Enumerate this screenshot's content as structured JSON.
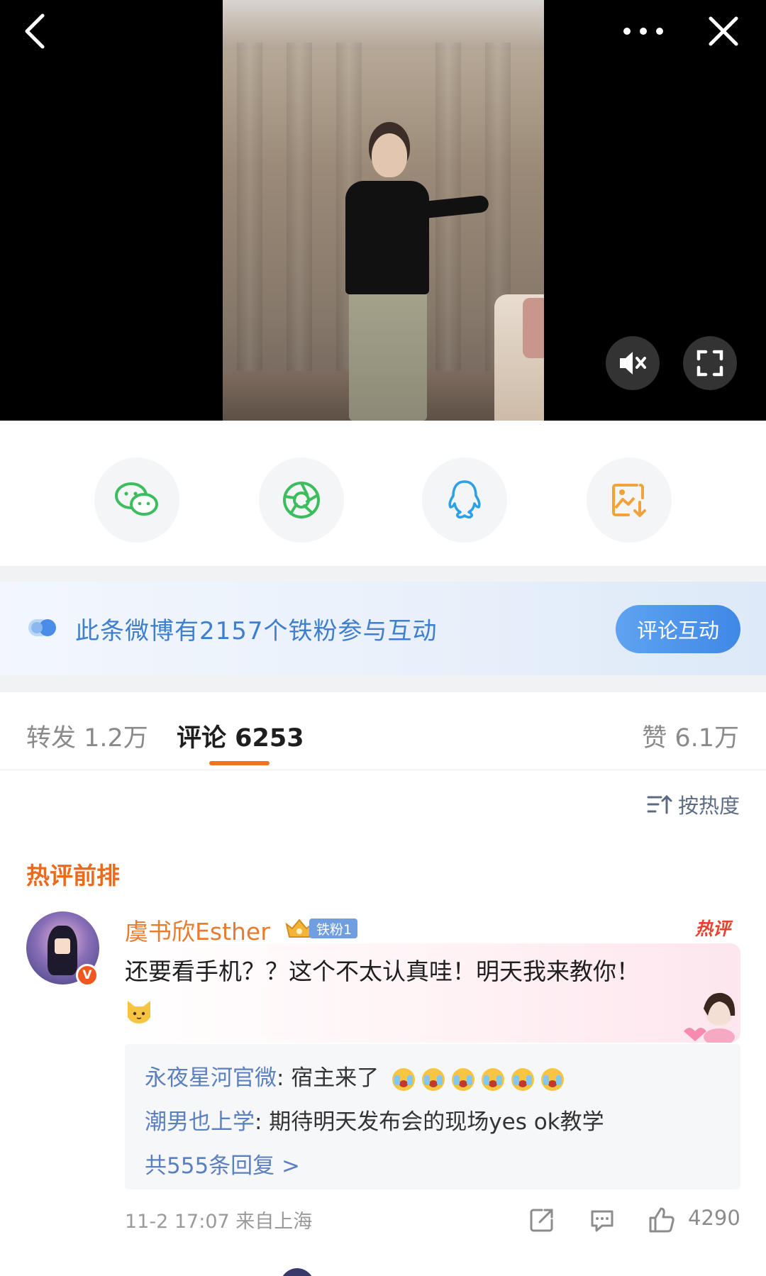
{
  "share": {
    "items": [
      {
        "name": "wechat-share",
        "color": "#3dbd5e"
      },
      {
        "name": "moments-share",
        "color": "#3dbd5e"
      },
      {
        "name": "qq-share",
        "color": "#2ea0e8"
      },
      {
        "name": "save-image",
        "color": "#f1a23a"
      }
    ]
  },
  "banner": {
    "text": "此条微博有2157个铁粉参与互动",
    "button_label": "评论互动"
  },
  "tabs": {
    "repost": "转发 1.2万",
    "comments": "评论 6253",
    "likes": "赞 6.1万"
  },
  "sort": {
    "label": "按热度"
  },
  "hot_heading": "热评前排",
  "comment": {
    "author": "虞书欣Esther",
    "fan_badge": "铁粉1",
    "hot_badge": "热评",
    "verified": "V",
    "text": "还要看手机？？这个不太认真哇！明天我来教你！",
    "replies": [
      {
        "user": "永夜星河官微",
        "text": ": 宿主来了"
      },
      {
        "user": "潮男也上学",
        "text": ": 期待明天发布会的现场yes ok教学"
      }
    ],
    "more_replies": "共555条回复 >",
    "meta": "11-2 17:07  来自上海",
    "likes": "4290"
  },
  "colors": {
    "accent_orange": "#f0731f",
    "link_blue": "#5b7fbf",
    "banner_blue": "#3f7fce"
  }
}
